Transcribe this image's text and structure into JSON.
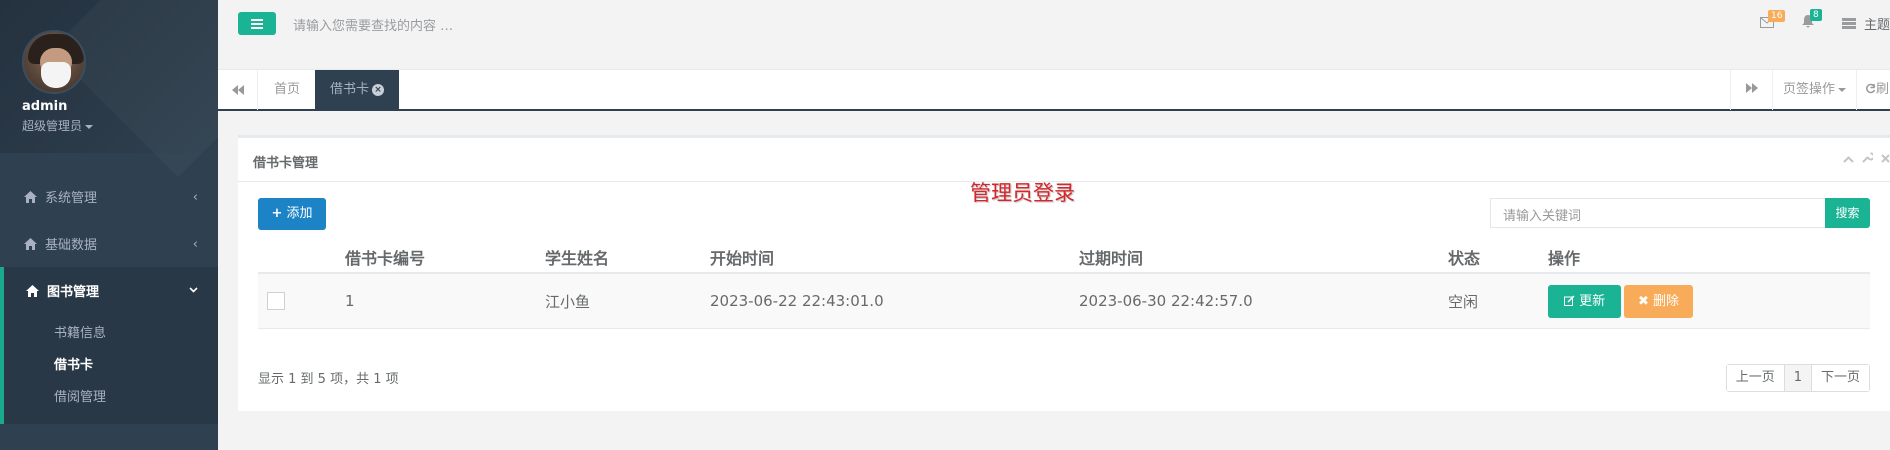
{
  "sidebar": {
    "user_name": "admin",
    "user_role": "超级管理员",
    "items": [
      {
        "label": "系统管理",
        "icon": "home-icon",
        "arrow": "‹"
      },
      {
        "label": "基础数据",
        "icon": "home-icon",
        "arrow": "‹"
      },
      {
        "label": "图书管理",
        "icon": "home-icon",
        "arrow": "⌄"
      }
    ],
    "submenu": [
      "书籍信息",
      "借书卡",
      "借阅管理"
    ]
  },
  "topbar": {
    "search_placeholder": "请输入您需要查找的内容 …",
    "mail_count": "16",
    "bell_count": "8",
    "theme_label": "主题"
  },
  "tabs": {
    "home": "首页",
    "active": "借书卡",
    "page_ops": "页签操作",
    "refresh": "刷"
  },
  "panel": {
    "title": "借书卡管理",
    "watermark": "管理员登录",
    "add_button": "添加",
    "search_placeholder": "请输入关键词",
    "search_button": "搜索"
  },
  "table": {
    "headers": [
      "借书卡编号",
      "学生姓名",
      "开始时间",
      "过期时间",
      "状态",
      "操作"
    ],
    "rows": [
      {
        "id": "1",
        "name": "江小鱼",
        "start": "2023-06-22 22:43:01.0",
        "end": "2023-06-30 22:42:57.0",
        "status": "空闲",
        "edit": "更新",
        "delete": "删除"
      }
    ]
  },
  "pagination": {
    "info": "显示 1 到 5 项，共 1 项",
    "prev": "上一页",
    "current": "1",
    "next": "下一页"
  },
  "colors": {
    "sidebar_bg": "#2f4050",
    "primary": "#1ab394",
    "info": "#1c84c6",
    "warning": "#f8ac59"
  }
}
